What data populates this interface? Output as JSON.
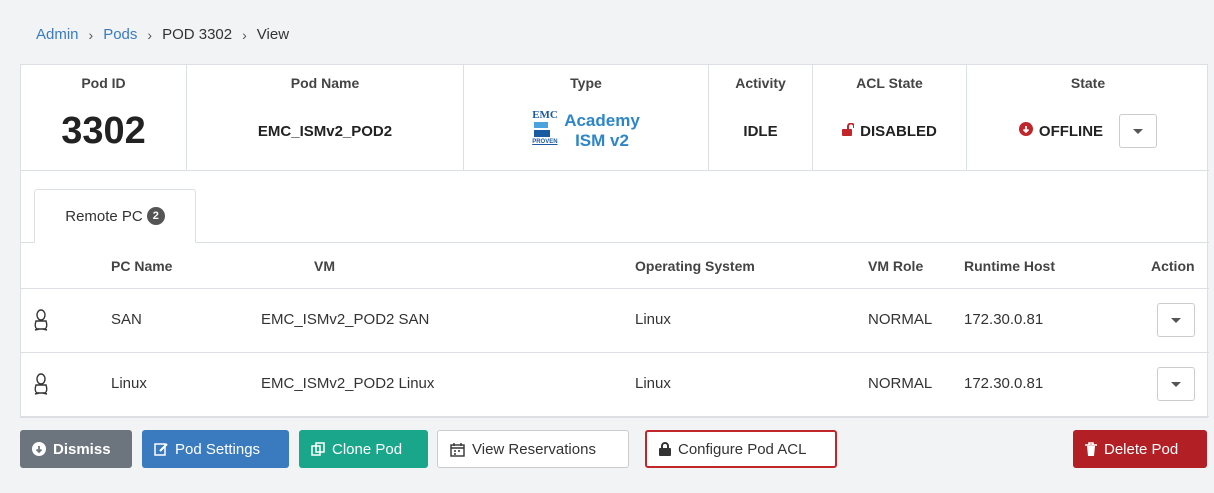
{
  "breadcrumb": {
    "items": [
      "Admin",
      "Pods",
      "POD 3302",
      "View"
    ],
    "separator": "›"
  },
  "info": {
    "pod_id_header": "Pod ID",
    "pod_id": "3302",
    "pod_name_header": "Pod Name",
    "pod_name": "EMC_ISMv2_POD2",
    "type_header": "Type",
    "type_line1": "Academy",
    "type_line2": "ISM v2",
    "logo_text": "EMC",
    "logo_sub": "PROVEN",
    "activity_header": "Activity",
    "activity": "IDLE",
    "acl_header": "ACL State",
    "acl": "DISABLED",
    "state_header": "State",
    "state": "OFFLINE"
  },
  "tabs": {
    "remote_pc_label": "Remote PC",
    "remote_pc_count": "2"
  },
  "table": {
    "headers": {
      "pc_name": "PC Name",
      "vm": "VM",
      "os": "Operating System",
      "vm_role": "VM Role",
      "runtime_host": "Runtime Host",
      "action": "Action"
    },
    "rows": [
      {
        "pc_name": "SAN",
        "vm": "EMC_ISMv2_POD2 SAN",
        "os": "Linux",
        "vm_role": "NORMAL",
        "runtime_host": "172.30.0.81"
      },
      {
        "pc_name": "Linux",
        "vm": "EMC_ISMv2_POD2 Linux",
        "os": "Linux",
        "vm_role": "NORMAL",
        "runtime_host": "172.30.0.81"
      }
    ]
  },
  "buttons": {
    "dismiss": "Dismiss",
    "pod_settings": "Pod Settings",
    "clone_pod": "Clone Pod",
    "view_reservations": "View Reservations",
    "configure_acl": "Configure Pod ACL",
    "delete_pod": "Delete Pod"
  },
  "colors": {
    "link": "#3a7bbf",
    "danger": "#c0262a",
    "teal": "#1aa68a",
    "gray": "#6c757d"
  }
}
